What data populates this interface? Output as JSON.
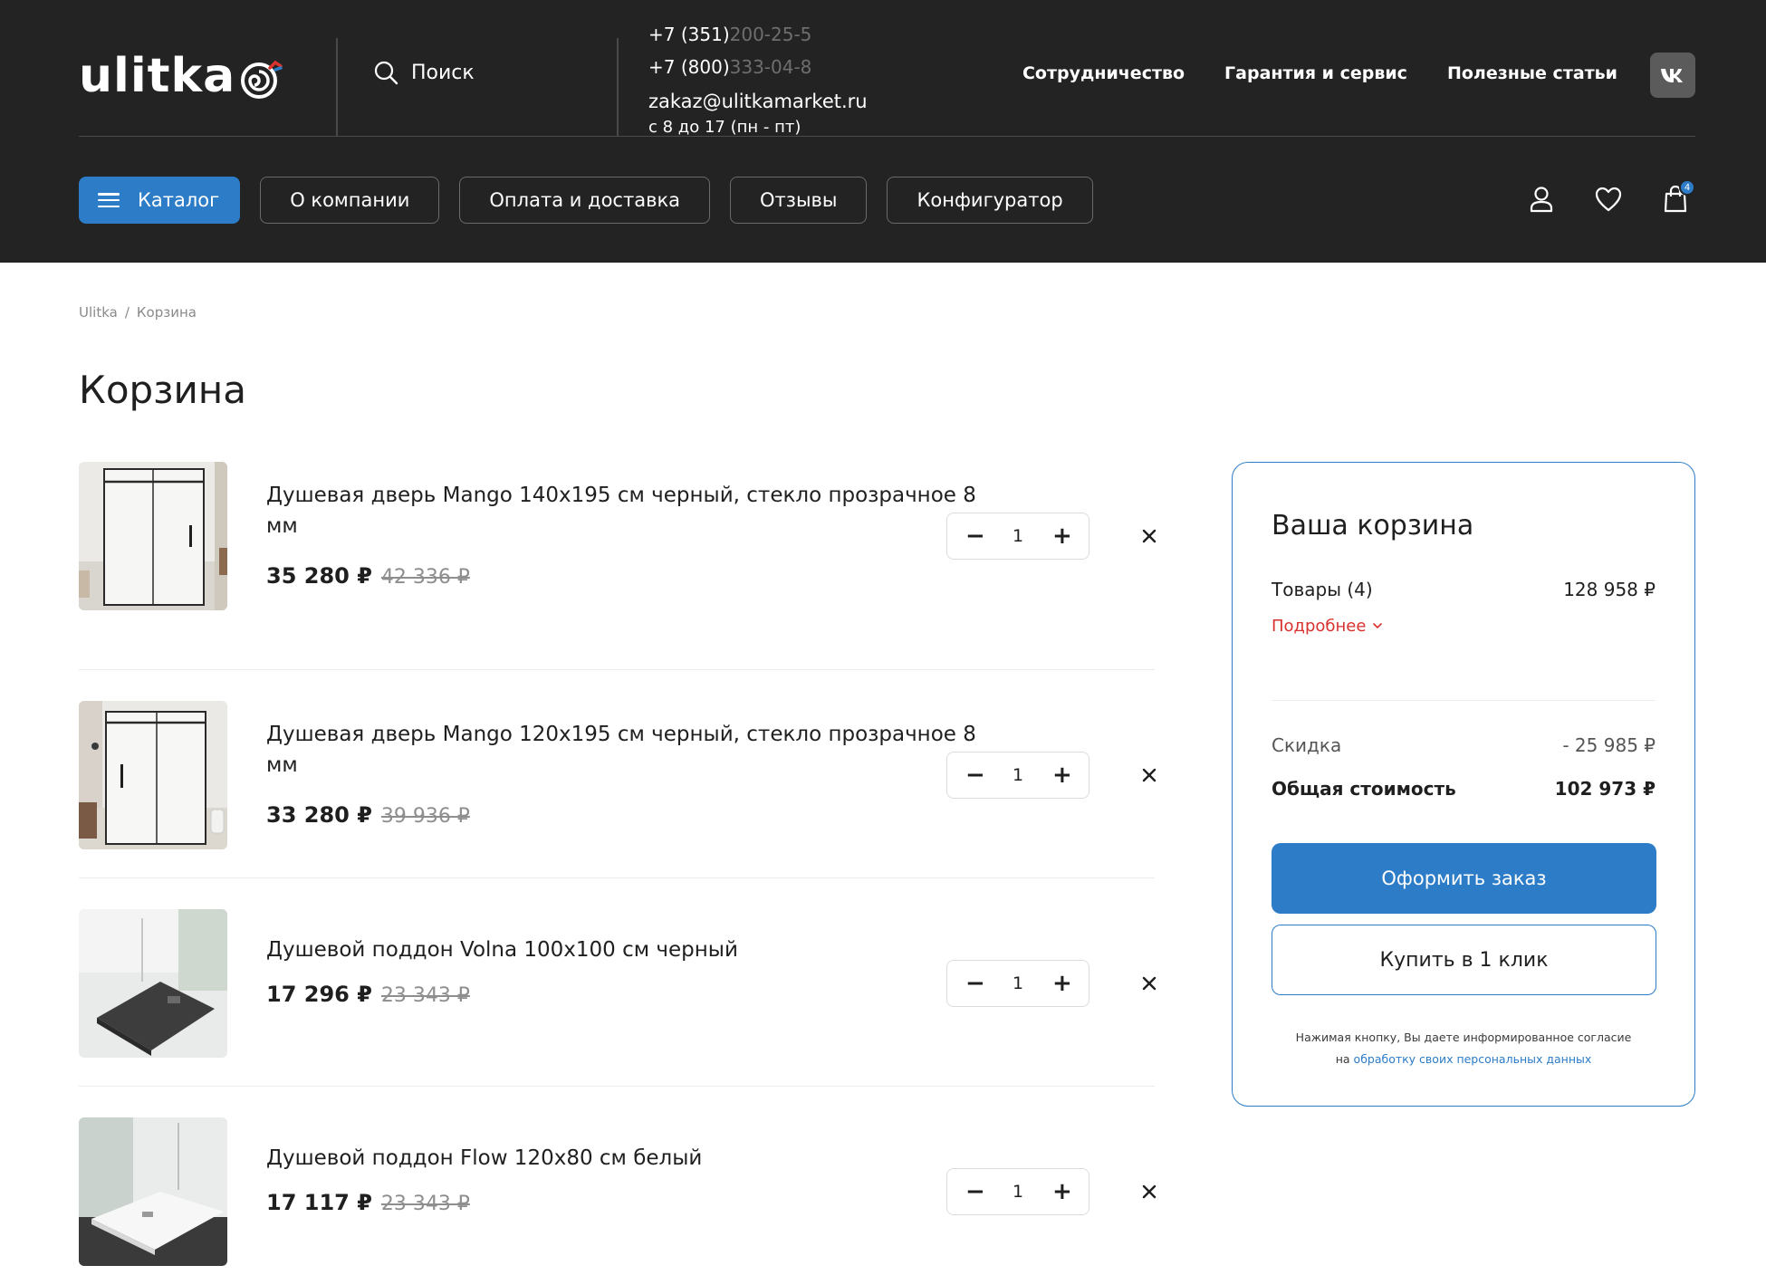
{
  "header": {
    "logo_text": "ulitka",
    "search_label": "Поиск",
    "phones": [
      {
        "visible": "+7 (351) ",
        "faded": "200-25-5"
      },
      {
        "visible": "+7 (800) ",
        "faded": "333-04-8"
      }
    ],
    "email": "zakaz@ulitkamarket.ru",
    "hours": "с 8 до 17 (пн - пт)",
    "top_links": [
      "Сотрудничество",
      "Гарантия и сервис",
      "Полезные статьи"
    ],
    "vk_label": "VK",
    "nav": [
      "Каталог",
      "О компании",
      "Оплата и доставка",
      "Отзывы",
      "Конфигуратор"
    ],
    "cart_count": "4"
  },
  "breadcrumb": {
    "home": "Ulitka",
    "separator": "/",
    "current": "Корзина"
  },
  "page_title": "Корзина",
  "items": [
    {
      "name": "Душевая дверь Mango 140x195 см черный, стекло прозрачное 8 мм",
      "price": "35 280 ₽",
      "old_price": "42 336 ₽",
      "qty": "1"
    },
    {
      "name": "Душевая дверь Mango 120x195 см черный, стекло прозрачное 8 мм",
      "price": "33 280 ₽",
      "old_price": "39 936 ₽",
      "qty": "1"
    },
    {
      "name": "Душевой поддон Volna 100x100 см черный",
      "price": "17 296 ₽",
      "old_price": "23 343 ₽",
      "qty": "1"
    },
    {
      "name": "Душевой поддон Flow 120x80 см белый",
      "price": "17 117 ₽",
      "old_price": "23 343 ₽",
      "qty": "1"
    }
  ],
  "summary": {
    "title": "Ваша корзина",
    "goods_label": "Товары (4)",
    "goods_value": "128 958 ₽",
    "details_link": "Подробнее",
    "discount_label": "Скидка",
    "discount_value": "- 25 985 ₽",
    "total_label": "Общая стоимость",
    "total_value": "102 973 ₽",
    "checkout_button": "Оформить заказ",
    "one_click_button": "Купить в 1 клик",
    "consent_text": "Нажимая кнопку, Вы даете информированное согласие",
    "consent_prefix": "на",
    "consent_link": "обработку своих персональных данных"
  },
  "colors": {
    "header_bg": "#232323",
    "accent": "#2c7cc7",
    "link_red": "#d8322f"
  }
}
